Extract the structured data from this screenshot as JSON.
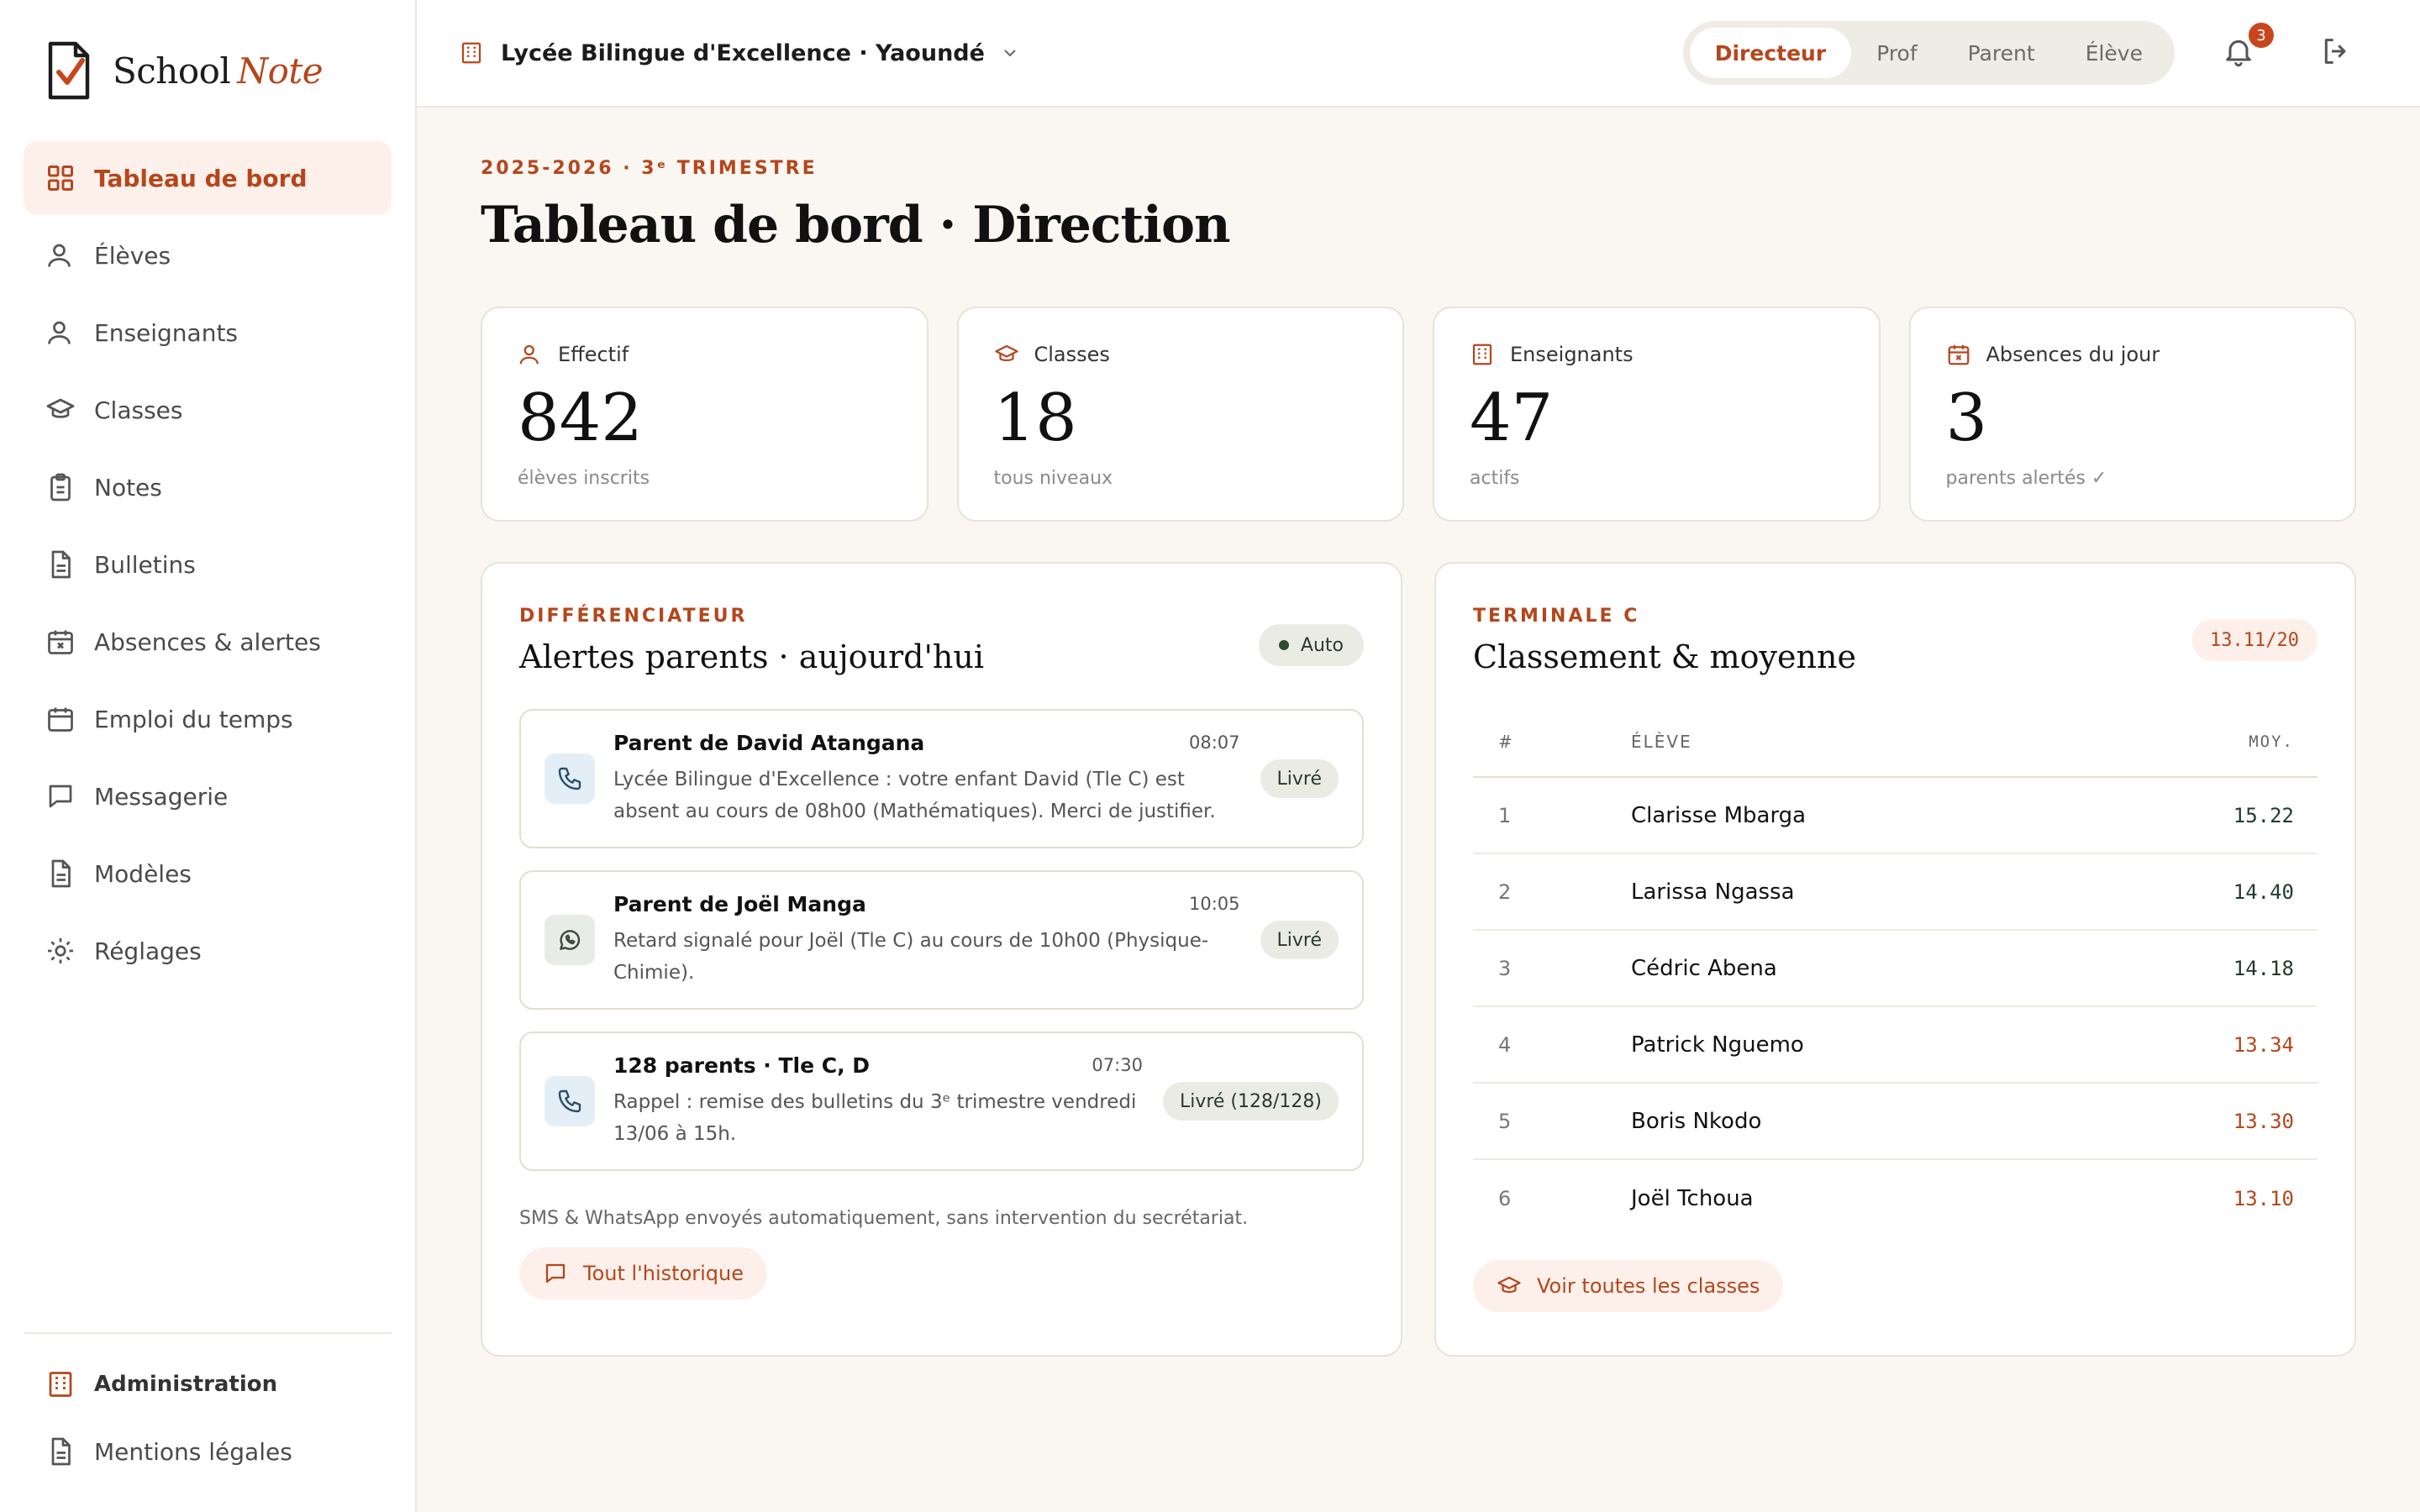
{
  "brand": {
    "name_part1": "School",
    "name_part2": "Note"
  },
  "sidebar": {
    "items": [
      {
        "label": "Tableau de bord",
        "icon": "grid-icon",
        "active": true
      },
      {
        "label": "Élèves",
        "icon": "user-icon"
      },
      {
        "label": "Enseignants",
        "icon": "user-icon"
      },
      {
        "label": "Classes",
        "icon": "graduation-cap-icon"
      },
      {
        "label": "Notes",
        "icon": "clipboard-icon"
      },
      {
        "label": "Bulletins",
        "icon": "document-icon"
      },
      {
        "label": "Absences & alertes",
        "icon": "calendar-x-icon"
      },
      {
        "label": "Emploi du temps",
        "icon": "calendar-icon"
      },
      {
        "label": "Messagerie",
        "icon": "chat-icon"
      },
      {
        "label": "Modèles",
        "icon": "document-icon"
      },
      {
        "label": "Réglages",
        "icon": "gear-icon"
      }
    ],
    "bottom": {
      "admin_label": "Administration",
      "legal_label": "Mentions légales"
    }
  },
  "topbar": {
    "school": "Lycée Bilingue d'Excellence · Yaoundé",
    "roles": [
      "Directeur",
      "Prof",
      "Parent",
      "Élève"
    ],
    "active_role": "Directeur",
    "notification_count": "3"
  },
  "page": {
    "eyebrow": "2025-2026 · 3ᵉ TRIMESTRE",
    "title": "Tableau de bord · Direction"
  },
  "stats": [
    {
      "label": "Effectif",
      "value": "842",
      "sub": "élèves inscrits",
      "icon": "user-icon"
    },
    {
      "label": "Classes",
      "value": "18",
      "sub": "tous niveaux",
      "icon": "graduation-cap-icon"
    },
    {
      "label": "Enseignants",
      "value": "47",
      "sub": "actifs",
      "icon": "building-icon"
    },
    {
      "label": "Absences du jour",
      "value": "3",
      "sub": "parents alertés ✓",
      "icon": "calendar-x-icon"
    }
  ],
  "alerts_panel": {
    "eyebrow": "DIFFÉRENCIATEUR",
    "title": "Alertes parents · aujourd'hui",
    "badge": "Auto",
    "items": [
      {
        "channel": "phone-icon",
        "name": "Parent de David Atangana",
        "time": "08:07",
        "message": "Lycée Bilingue d'Excellence : votre enfant David (Tle C) est absent au cours de 08h00 (Mathématiques). Merci de justifier.",
        "status": "Livré"
      },
      {
        "channel": "whatsapp-icon",
        "name": "Parent de Joël Manga",
        "time": "10:05",
        "message": "Retard signalé pour Joël (Tle C) au cours de 10h00 (Physique-Chimie).",
        "status": "Livré"
      },
      {
        "channel": "phone-icon",
        "name": "128 parents · Tle C, D",
        "time": "07:30",
        "message": "Rappel : remise des bulletins du 3ᵉ trimestre vendredi 13/06 à 15h.",
        "status": "Livré (128/128)"
      }
    ],
    "note": "SMS & WhatsApp envoyés automatiquement, sans intervention du secrétariat.",
    "button": "Tout l'historique"
  },
  "ranking_panel": {
    "eyebrow": "TERMINALE C",
    "title": "Classement & moyenne",
    "badge": "13.11/20",
    "columns": {
      "num": "#",
      "name": "ÉLÈVE",
      "avg": "MOY."
    },
    "rows": [
      {
        "rank": "1",
        "name": "Clarisse Mbarga",
        "avg": "15.22",
        "tone": "good"
      },
      {
        "rank": "2",
        "name": "Larissa Ngassa",
        "avg": "14.40",
        "tone": "good"
      },
      {
        "rank": "3",
        "name": "Cédric Abena",
        "avg": "14.18",
        "tone": "good"
      },
      {
        "rank": "4",
        "name": "Patrick Nguemo",
        "avg": "13.34",
        "tone": "warn"
      },
      {
        "rank": "5",
        "name": "Boris Nkodo",
        "avg": "13.30",
        "tone": "warn"
      },
      {
        "rank": "6",
        "name": "Joël Tchoua",
        "avg": "13.10",
        "tone": "warn"
      }
    ],
    "button": "Voir toutes les classes"
  },
  "colors": {
    "accent": "#b5461c",
    "good": "#1f3b2e",
    "background": "#faf7f2"
  }
}
